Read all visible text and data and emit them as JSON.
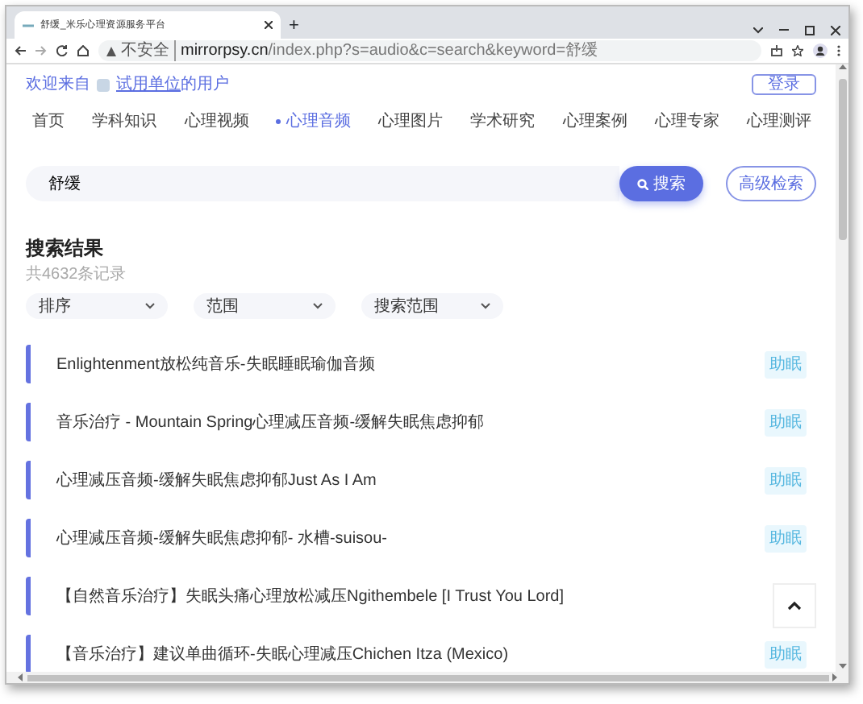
{
  "browser": {
    "tab_title": "舒缓_米乐心理资源服务平台",
    "new_tab": "+",
    "url_secure_label": "不安全",
    "url_domain": "mirrorpsy.cn",
    "url_path": "/index.php?s=audio&c=search&keyword=舒缓"
  },
  "header": {
    "welcome": "欢迎来自",
    "org_link": "试用单位",
    "org_suffix": "的用户",
    "login": "登录"
  },
  "nav": [
    {
      "label": "首页",
      "selected": false
    },
    {
      "label": "学科知识",
      "selected": false
    },
    {
      "label": "心理视频",
      "selected": false
    },
    {
      "label": "心理音频",
      "selected": true
    },
    {
      "label": "心理图片",
      "selected": false
    },
    {
      "label": "学术研究",
      "selected": false
    },
    {
      "label": "心理案例",
      "selected": false
    },
    {
      "label": "心理专家",
      "selected": false
    },
    {
      "label": "心理测评",
      "selected": false
    }
  ],
  "search": {
    "value": "舒缓",
    "button": "搜索",
    "advanced": "高级检索"
  },
  "results": {
    "title": "搜索结果",
    "count": "共4632条记录",
    "filters": [
      "排序",
      "范围",
      "搜索范围"
    ],
    "items": [
      {
        "title": "Enlightenment放松纯音乐-失眠睡眠瑜伽音频",
        "tag": "助眠"
      },
      {
        "title": "音乐治疗 - Mountain Spring心理减压音频-缓解失眠焦虑抑郁",
        "tag": "助眠"
      },
      {
        "title": "心理减压音频-缓解失眠焦虑抑郁Just As I Am",
        "tag": "助眠"
      },
      {
        "title": "心理减压音频-缓解失眠焦虑抑郁- 水槽-suisou-",
        "tag": "助眠"
      },
      {
        "title": "【自然音乐治疗】失眠头痛心理放松减压Ngithembele [I Trust You Lord]"
      },
      {
        "title": "【音乐治疗】建议单曲循环-失眠心理减压Chichen Itza (Mexico)",
        "tag": "助眠"
      }
    ]
  }
}
